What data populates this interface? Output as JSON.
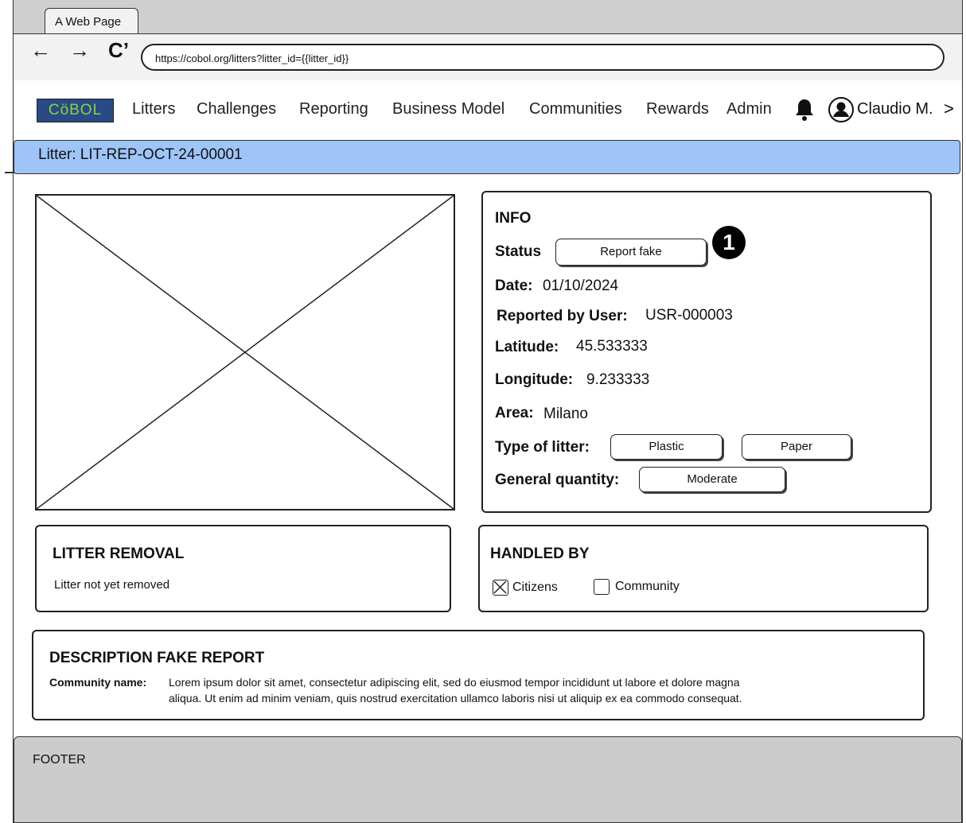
{
  "browser": {
    "tab_title": "A Web Page",
    "url": "https://cobol.org/litters?litter_id={{litter_id}}",
    "back_icon": "arrow-left-icon",
    "forward_icon": "arrow-right-icon",
    "reload_icon": "reload-icon"
  },
  "nav": {
    "logo": "CöBOL",
    "items": [
      "Litters",
      "Challenges",
      "Reporting",
      "Business Model",
      "Communities",
      "Rewards",
      "Admin"
    ],
    "user": "Claudio M.",
    "chevron": ">"
  },
  "crumb": "Litter: LIT-REP-OCT-24-00001",
  "info": {
    "title": "INFO",
    "status_label": "Status",
    "status_button": "Report fake",
    "marker": "1",
    "date_label": "Date:",
    "date_value": "01/10/2024",
    "reported_label": "Reported by User:",
    "reported_value": "USR-000003",
    "lat_label": "Latitude:",
    "lat_value": "45.533333",
    "lon_label": "Longitude:",
    "lon_value": "9.233333",
    "area_label": "Area:",
    "area_value": "Milano",
    "type_label": "Type of litter:",
    "types": [
      "Plastic",
      "Paper"
    ],
    "quantity_label": "General quantity:",
    "quantity_value": "Moderate"
  },
  "removal": {
    "title": "LITTER REMOVAL",
    "text": "Litter not yet removed"
  },
  "handled": {
    "title": "HANDLED BY",
    "citizens_label": "Citizens",
    "citizens_checked": true,
    "community_label": "Community",
    "community_checked": false
  },
  "description": {
    "title": "DESCRIPTION FAKE REPORT",
    "name_label": "Community name:",
    "line1": "Lorem ipsum dolor sit amet, consectetur adipiscing elit, sed do eiusmod tempor incididunt ut labore et dolore magna",
    "line2": "aliqua. Ut enim ad minim veniam, quis nostrud exercitation ullamco laboris nisi ut aliquip ex ea commodo consequat."
  },
  "footer": "FOOTER"
}
